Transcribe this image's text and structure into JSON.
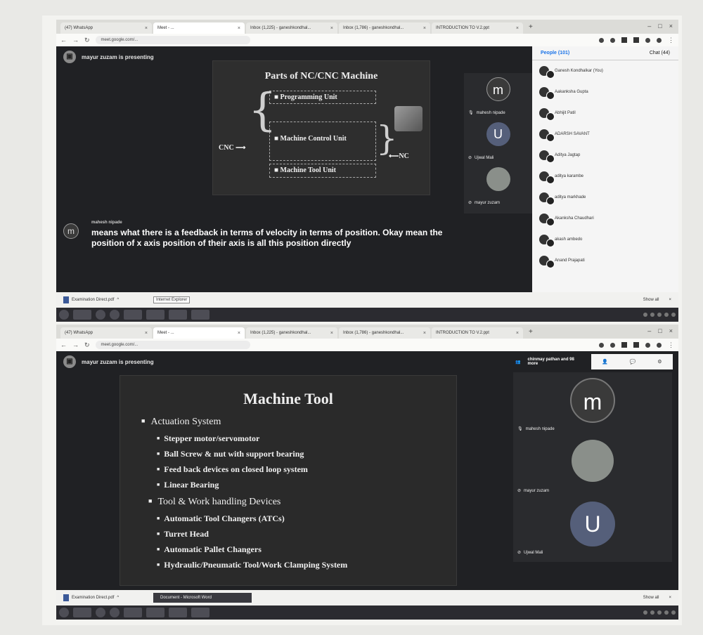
{
  "shot1": {
    "tabs": [
      {
        "label": "(47) WhatsApp",
        "active": false
      },
      {
        "label": "Meet - ...",
        "active": true
      },
      {
        "label": "Inbox (1,225) - ganeshkondhal...",
        "active": false
      },
      {
        "label": "Inbox (1,786) - ganeshkondhal...",
        "active": false
      },
      {
        "label": "INTRODUCTION TO V.2.ppt",
        "active": false
      }
    ],
    "url": "meet.google.com/...",
    "presenting": "mayur zuzam is presenting",
    "slide": {
      "title": "Parts of NC/CNC Machine",
      "items": [
        "Programming Unit",
        "Machine Control Unit",
        "Machine Tool Unit"
      ],
      "cnc_label": "CNC",
      "nc_label": "NC"
    },
    "tiles": [
      {
        "initial": "m",
        "name": "mahesh nipade",
        "color": "#3a3a3a"
      },
      {
        "initial": "U",
        "name": "Ujwal Mali",
        "color": "#555f7a"
      },
      {
        "initial": "",
        "name": "mayur zuzam",
        "color": "#8a8f8a"
      }
    ],
    "caption": {
      "initial": "m",
      "speaker": "mahesh nipade",
      "text": "means what there is a feedback in terms of velocity in terms of position. Okay mean the position of x axis position of their axis is all this position directly"
    },
    "people_panel": {
      "tab_people": "People (101)",
      "tab_chat": "Chat (44)",
      "people": [
        "Ganesh Kondhalkar (You)",
        "Aakanksha Gupta",
        "Abhijit Patil",
        "ADARSH SAVANT",
        "Aditya Jagtap",
        "aditya karambe",
        "aditya markhade",
        "Akanksha Chaudhari",
        "akash ambedo",
        "Anand Prajapati"
      ]
    },
    "download": {
      "file": "Examination Direct.pdf",
      "show_all": "Show all",
      "tooltip": "Internet Explorer"
    }
  },
  "shot2": {
    "tabs": [
      {
        "label": "(47) WhatsApp",
        "active": false
      },
      {
        "label": "Meet - ...",
        "active": true
      },
      {
        "label": "Inbox (1,225) - ganeshkondhal...",
        "active": false
      },
      {
        "label": "Inbox (1,786) - ganeshkondhal...",
        "active": false
      },
      {
        "label": "INTRODUCTION TO V.2.ppt",
        "active": false
      }
    ],
    "url": "meet.google.com/...",
    "presenting": "mayur zuzam is presenting",
    "top_right_text": "chinmay pathan and 98 more",
    "slide": {
      "title": "Machine Tool",
      "l1_a": "Actuation System",
      "a_items": [
        "Stepper motor/servomotor",
        "Ball Screw & nut with support bearing",
        "Feed back devices on closed loop system",
        "Linear Bearing"
      ],
      "l1_b": "Tool & Work handling Devices",
      "b_items": [
        "Automatic Tool Changers (ATCs)",
        "Turret Head",
        "Automatic Pallet Changers",
        "Hydraulic/Pneumatic Tool/Work Clamping System"
      ]
    },
    "tiles": [
      {
        "initial": "m",
        "name": "mahesh nipade",
        "color": "#3a3a3a"
      },
      {
        "initial": "",
        "name": "mayur zuzam",
        "color": "#8a8f8a"
      },
      {
        "initial": "U",
        "name": "Ujwal Mali",
        "color": "#555f7a"
      }
    ],
    "download": {
      "file": "Examination Direct.pdf",
      "word_item": "Document - Microsoft Word",
      "show_all": "Show all"
    }
  }
}
